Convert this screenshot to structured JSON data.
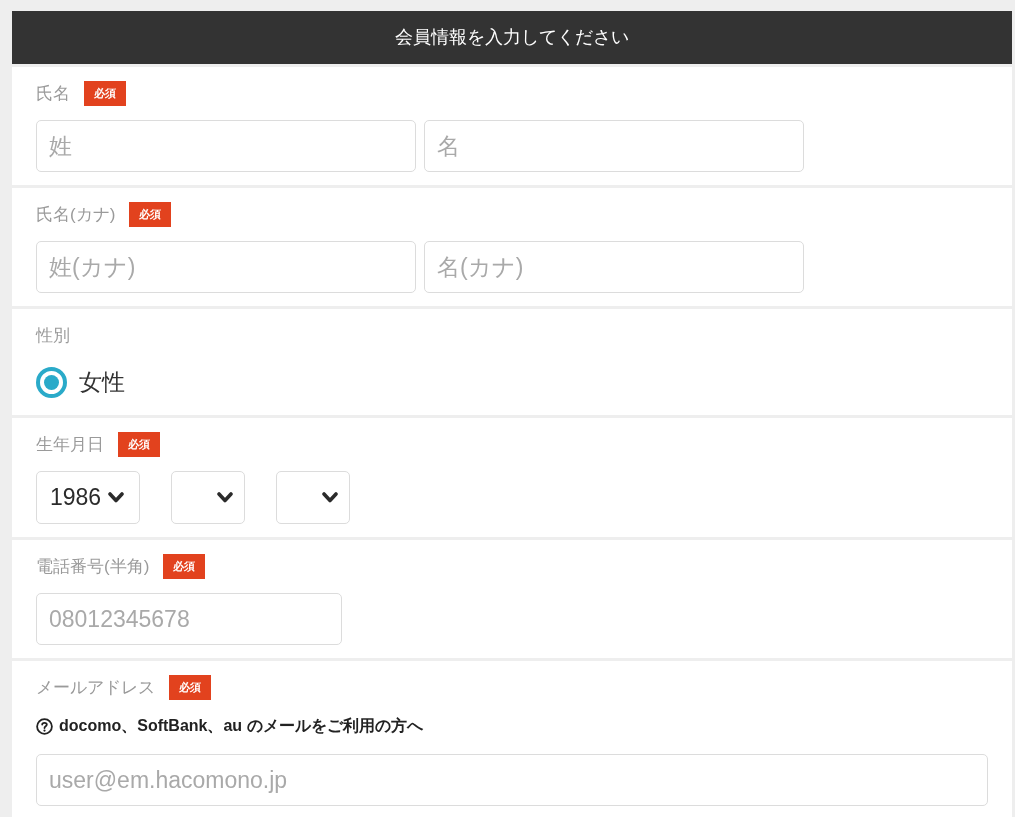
{
  "header": {
    "title": "会員情報を入力してください"
  },
  "sections": [
    {
      "kind": "name_pair",
      "label": "氏名",
      "badge": "必須",
      "fields": [
        {
          "placeholder": "姓"
        },
        {
          "placeholder": "名"
        }
      ]
    },
    {
      "kind": "name_pair",
      "label": "氏名(カナ)",
      "badge": "必須",
      "fields": [
        {
          "placeholder": "姓(カナ)"
        },
        {
          "placeholder": "名(カナ)"
        }
      ]
    },
    {
      "kind": "radio",
      "label": "性別",
      "options": [
        {
          "label": "女性",
          "selected": true
        }
      ]
    },
    {
      "kind": "dropdowns",
      "label": "生年月日",
      "badge": "必須",
      "dropdowns": [
        {
          "kind": "filled",
          "value": "1986"
        },
        {
          "kind": "blank"
        },
        {
          "kind": "blank"
        }
      ]
    },
    {
      "kind": "phone",
      "label": "電話番号(半角)",
      "badge": "必須",
      "fields": [
        {
          "placeholder": "08012345678"
        }
      ]
    },
    {
      "kind": "email",
      "label": "メールアドレス",
      "badge": "必須",
      "help_link": "docomo、SoftBank、au のメールをご利用の方へ",
      "fields": [
        {
          "placeholder": "user@em.hacomono.jp"
        }
      ]
    }
  ]
}
